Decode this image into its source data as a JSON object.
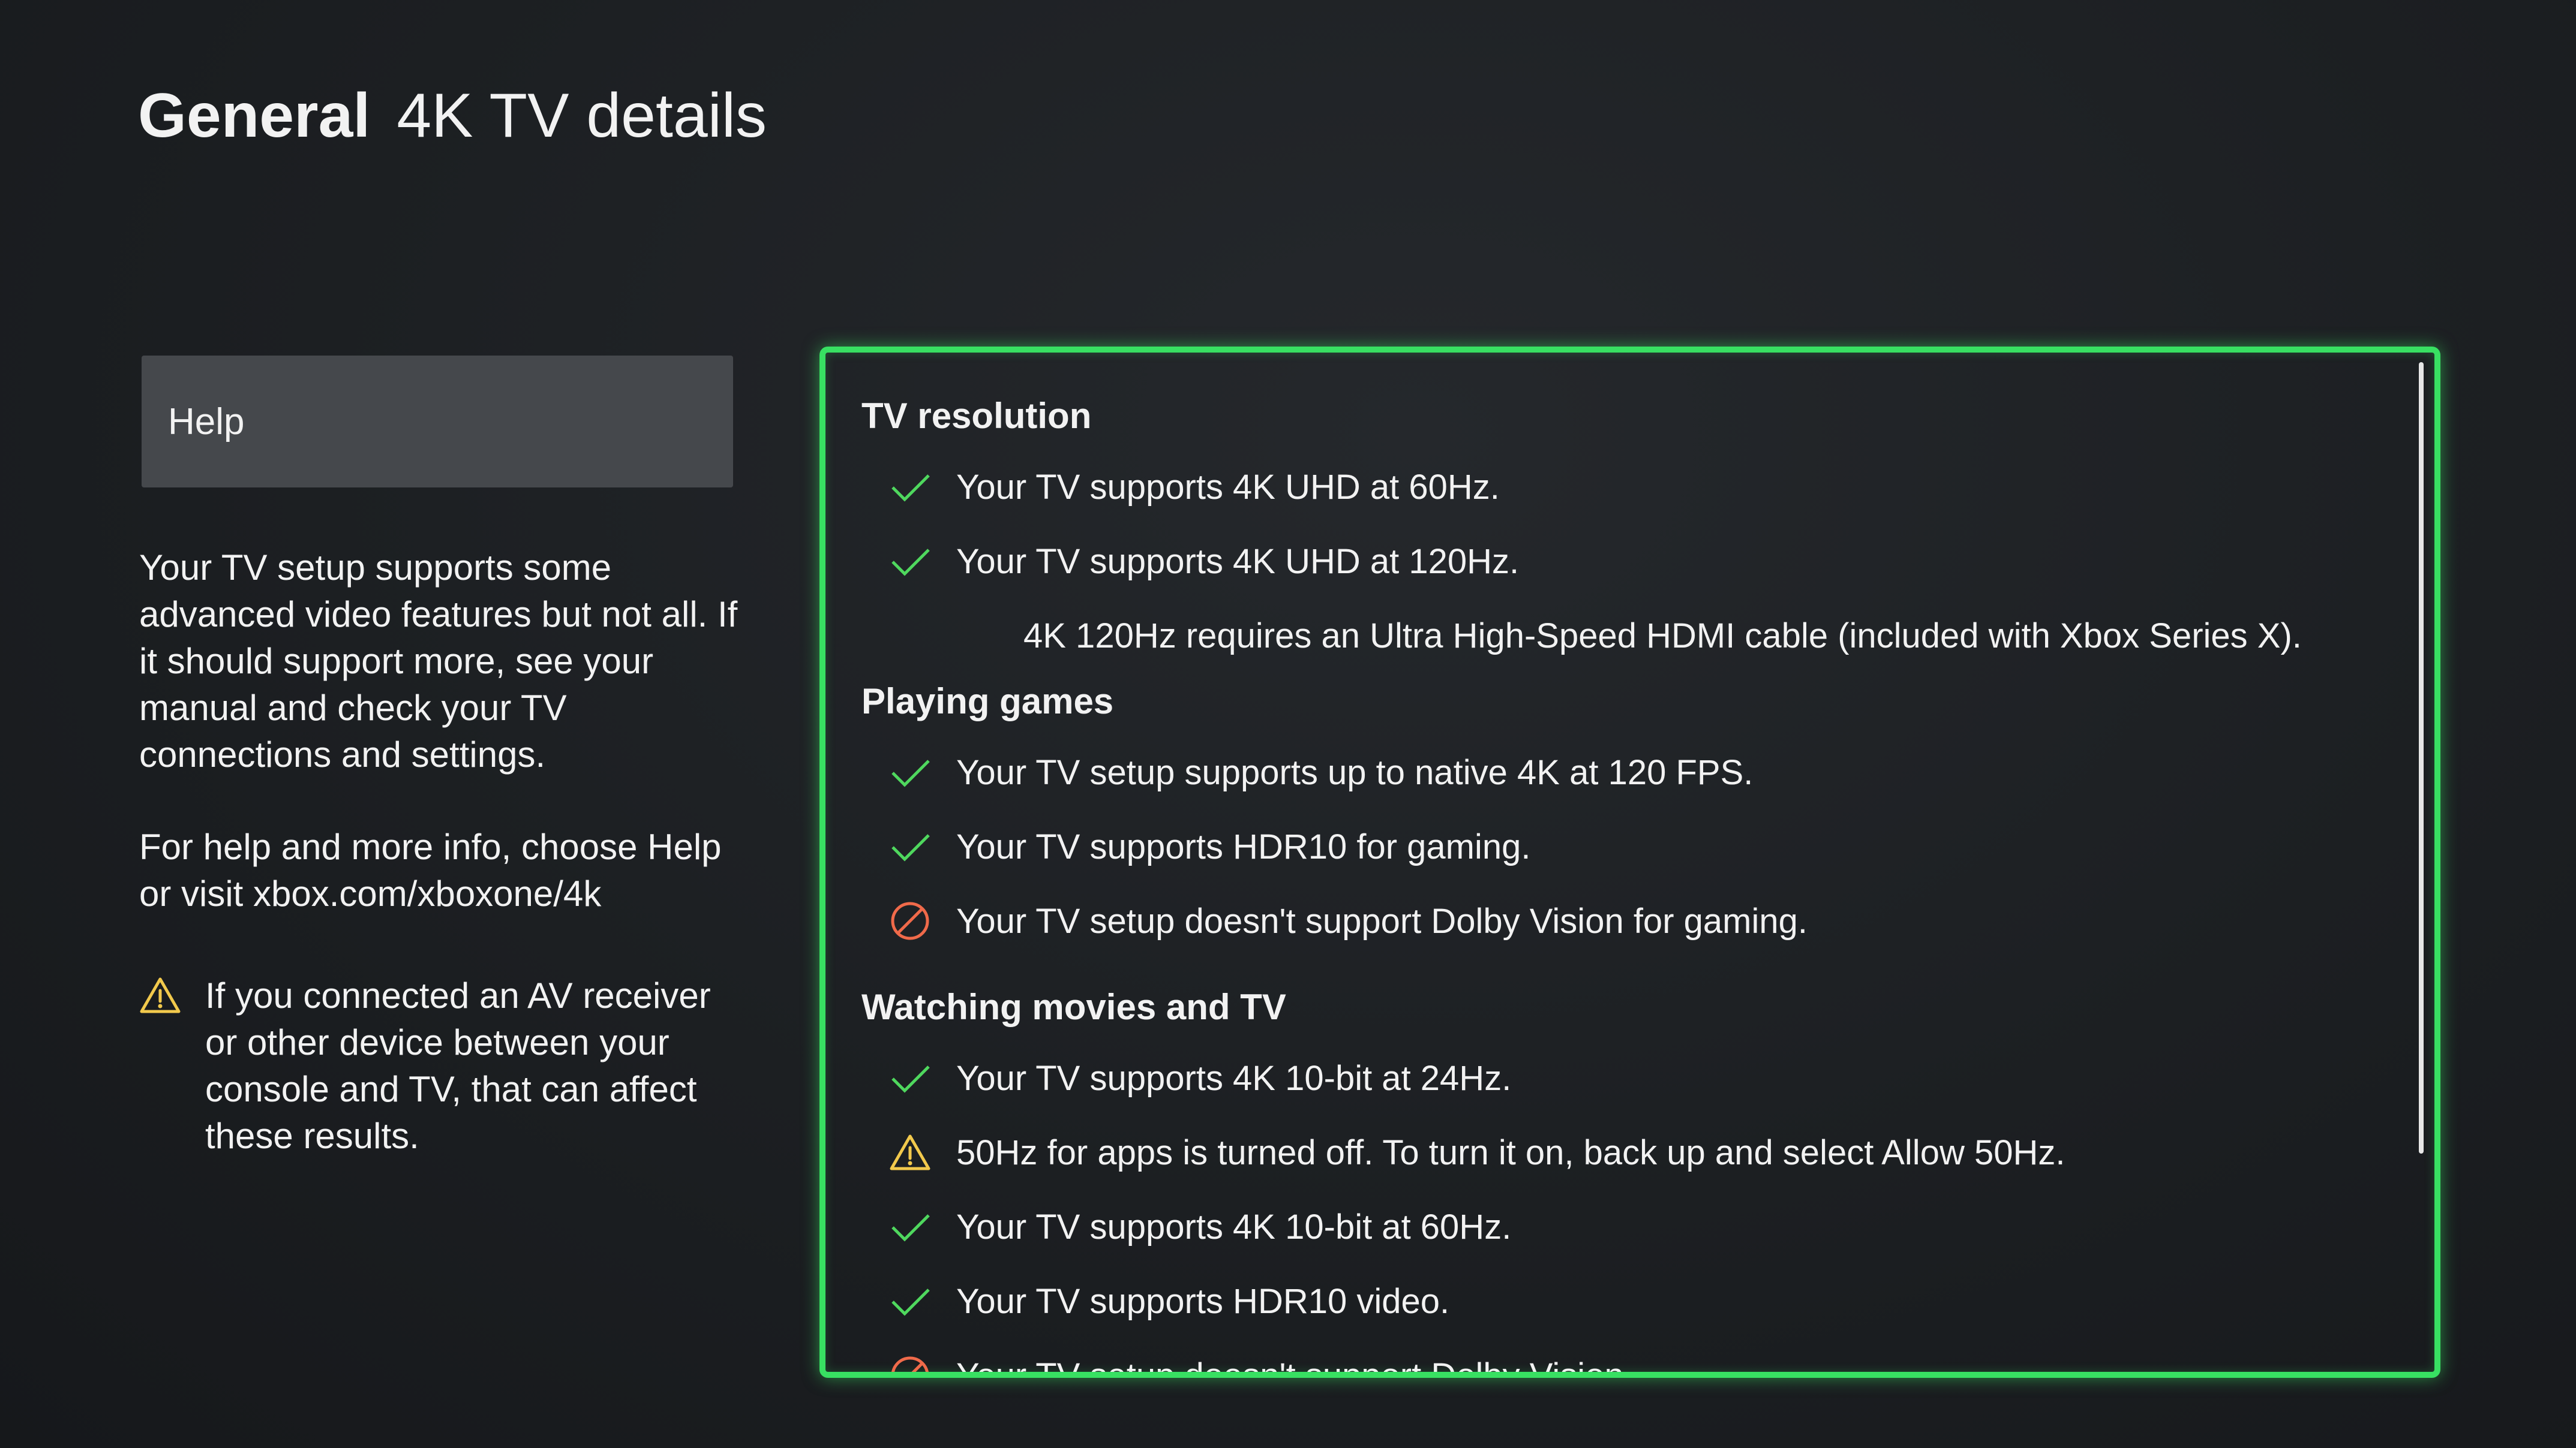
{
  "header": {
    "section": "General",
    "title": "4K TV details"
  },
  "sidebar": {
    "help_button_label": "Help",
    "description": "Your TV setup supports some advanced video features but not all. If it should support more, see your manual and check your TV connections and settings.",
    "help_info": "For help and more info, choose Help or visit xbox.com/xboxone/4k",
    "warning_note": "If you connected an AV receiver or other device between your console and TV, that can affect these results."
  },
  "colors": {
    "check": "#4fd85e",
    "blocked": "#f06a4a",
    "warning": "#f2c94c",
    "focus_border": "#38e062"
  },
  "sections": [
    {
      "title": "TV resolution",
      "items": [
        {
          "status": "check",
          "icon": "check-icon",
          "text": "Your TV supports 4K UHD at 60Hz."
        },
        {
          "status": "check",
          "icon": "check-icon",
          "text": "Your TV supports 4K UHD at 120Hz."
        }
      ],
      "note": "4K 120Hz requires an Ultra High-Speed HDMI cable (included with Xbox Series X)."
    },
    {
      "title": "Playing games",
      "items": [
        {
          "status": "check",
          "icon": "check-icon",
          "text": "Your TV setup supports up to native 4K at 120 FPS."
        },
        {
          "status": "check",
          "icon": "check-icon",
          "text": "Your TV supports HDR10 for gaming."
        },
        {
          "status": "blocked",
          "icon": "blocked-icon",
          "text": "Your TV setup doesn't support Dolby Vision for gaming."
        }
      ]
    },
    {
      "title": "Watching movies and TV",
      "items": [
        {
          "status": "check",
          "icon": "check-icon",
          "text": "Your TV supports 4K 10-bit at 24Hz."
        },
        {
          "status": "warning",
          "icon": "warning-icon",
          "text": "50Hz for apps is turned off. To turn it on, back up and select Allow 50Hz."
        },
        {
          "status": "check",
          "icon": "check-icon",
          "text": "Your TV supports 4K 10-bit at 60Hz."
        },
        {
          "status": "check",
          "icon": "check-icon",
          "text": "Your TV supports HDR10 video."
        },
        {
          "status": "blocked",
          "icon": "blocked-icon",
          "text": "Your TV setup doesn't support Dolby Vision"
        }
      ]
    }
  ]
}
